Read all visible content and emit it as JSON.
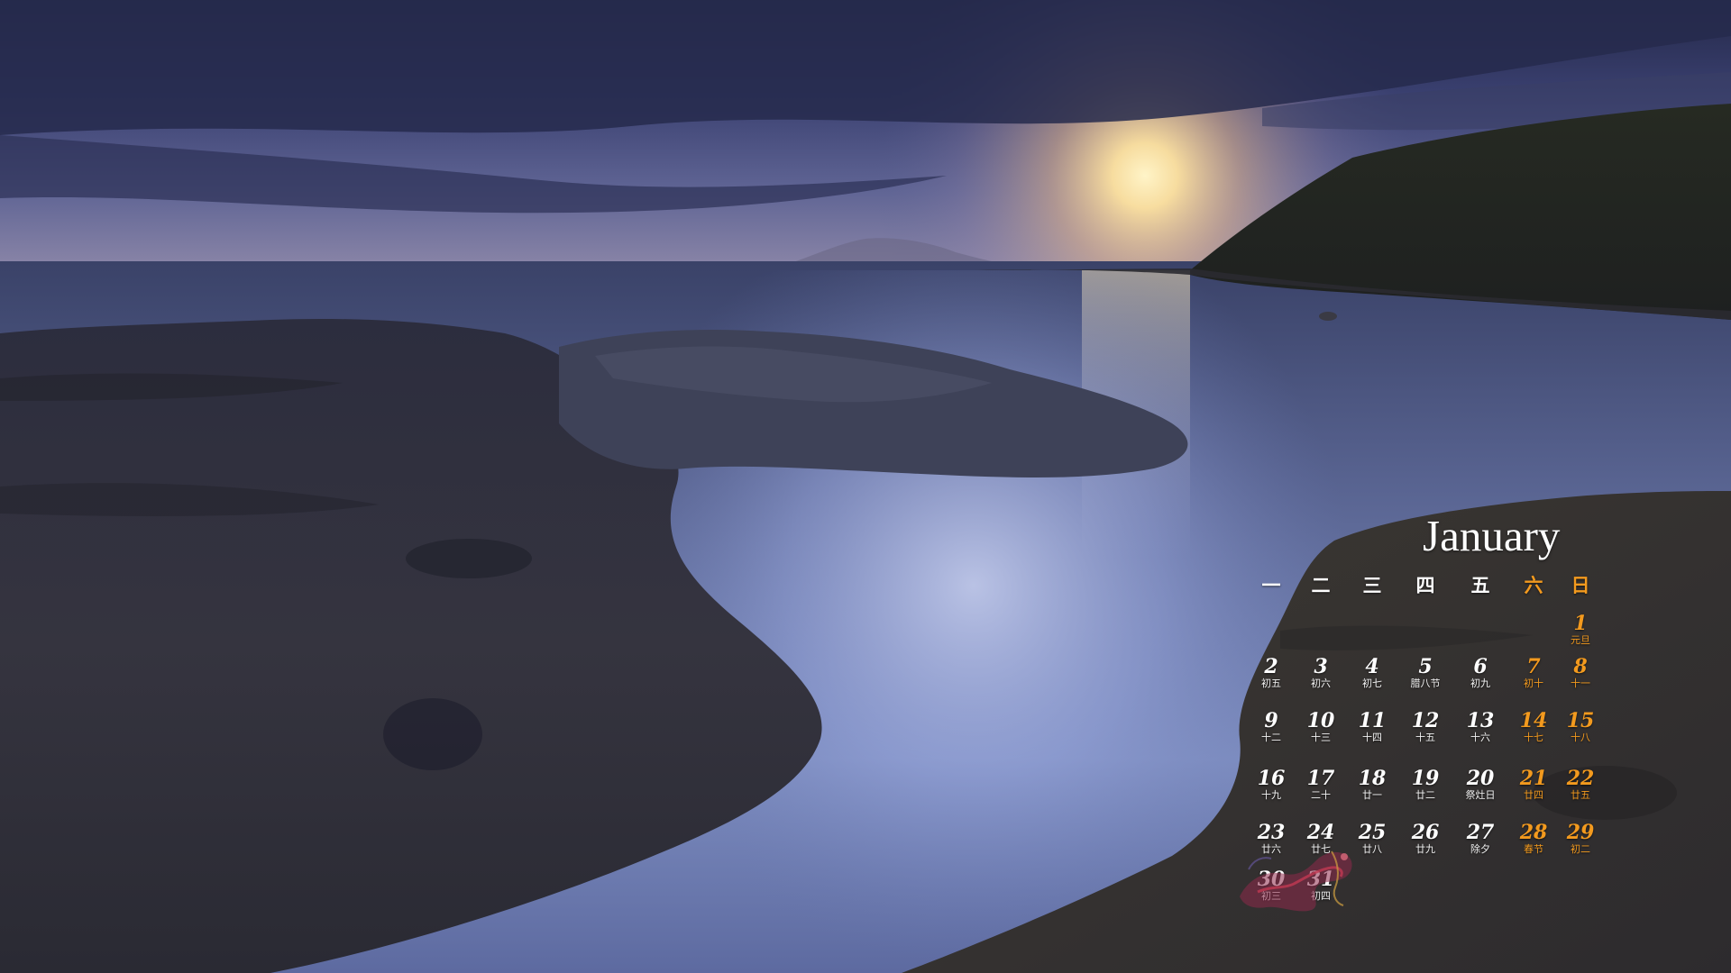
{
  "calendar": {
    "month": "January",
    "weekdays": [
      "一",
      "二",
      "三",
      "四",
      "五",
      "六",
      "日"
    ],
    "weekend_color": "#f39a1e",
    "text_color": "#ffffff",
    "days": [
      {
        "num": "1",
        "sub": "元旦"
      },
      {
        "num": "2",
        "sub": "初五"
      },
      {
        "num": "3",
        "sub": "初六"
      },
      {
        "num": "4",
        "sub": "初七"
      },
      {
        "num": "5",
        "sub": "腊八节"
      },
      {
        "num": "6",
        "sub": "初九"
      },
      {
        "num": "7",
        "sub": "初十"
      },
      {
        "num": "8",
        "sub": "十一"
      },
      {
        "num": "9",
        "sub": "十二"
      },
      {
        "num": "10",
        "sub": "十三"
      },
      {
        "num": "11",
        "sub": "十四"
      },
      {
        "num": "12",
        "sub": "十五"
      },
      {
        "num": "13",
        "sub": "十六"
      },
      {
        "num": "14",
        "sub": "十七"
      },
      {
        "num": "15",
        "sub": "十八"
      },
      {
        "num": "16",
        "sub": "十九"
      },
      {
        "num": "17",
        "sub": "二十"
      },
      {
        "num": "18",
        "sub": "廿一"
      },
      {
        "num": "19",
        "sub": "廿二"
      },
      {
        "num": "20",
        "sub": "祭灶日"
      },
      {
        "num": "21",
        "sub": "廿四"
      },
      {
        "num": "22",
        "sub": "廿五"
      },
      {
        "num": "23",
        "sub": "廿六"
      },
      {
        "num": "24",
        "sub": "廿七"
      },
      {
        "num": "25",
        "sub": "廿八"
      },
      {
        "num": "26",
        "sub": "廿九"
      },
      {
        "num": "27",
        "sub": "除夕"
      },
      {
        "num": "28",
        "sub": "春节"
      },
      {
        "num": "29",
        "sub": "初二"
      },
      {
        "num": "30",
        "sub": "初三"
      },
      {
        "num": "31",
        "sub": "初四"
      }
    ]
  }
}
